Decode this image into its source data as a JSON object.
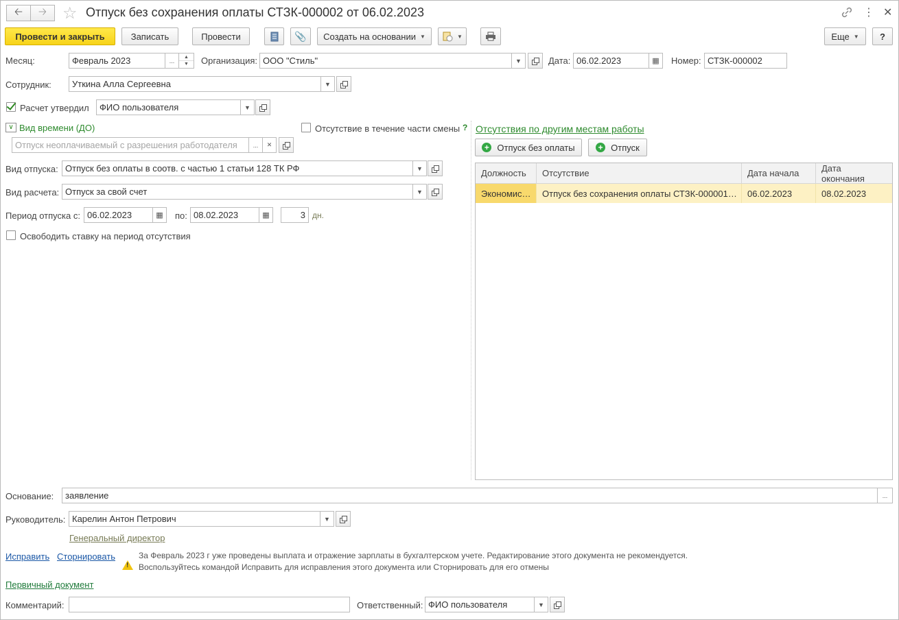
{
  "window": {
    "title": "Отпуск без сохранения оплаты СТЗК-000002 от 06.02.2023"
  },
  "toolbar": {
    "post_close_label": "Провести и закрыть",
    "save_label": "Записать",
    "post_label": "Провести",
    "create_based_label": "Создать на основании",
    "more_label": "Еще",
    "help_label": "?"
  },
  "header": {
    "month_label": "Месяц:",
    "month_value": "Февраль 2023",
    "org_label": "Организация:",
    "org_value": "ООО \"Стиль\"",
    "date_label": "Дата:",
    "date_value": "06.02.2023",
    "number_label": "Номер:",
    "number_value": "СТЗК-000002",
    "employee_label": "Сотрудник:",
    "employee_value": "Уткина Алла Сергеевна",
    "approved_label": "Расчет утвердил",
    "approved_value": "ФИО пользователя"
  },
  "left": {
    "time_kind_label": "Вид времени (ДО)",
    "partial_shift_label": "Отсутствие в течение части смены",
    "help_mark": "?",
    "time_kind_placeholder": "Отпуск неоплачиваемый с разрешения работодателя",
    "leave_kind_label": "Вид отпуска:",
    "leave_kind_value": "Отпуск без оплаты в соотв. с частью 1 статьи 128 ТК РФ",
    "calc_kind_label": "Вид расчета:",
    "calc_kind_value": "Отпуск за свой счет",
    "period_from_label": "Период отпуска с:",
    "period_from_value": "06.02.2023",
    "period_to_label": "по:",
    "period_to_value": "08.02.2023",
    "days_value": "3",
    "days_unit": "дн.",
    "free_rate_label": "Освободить ставку на период отсутствия"
  },
  "right": {
    "section_title": "Отсутствия по другим местам работы",
    "btn_unpaid_label": "Отпуск без оплаты",
    "btn_leave_label": "Отпуск",
    "columns": [
      "Должность",
      "Отсутствие",
      "Дата начала",
      "Дата окончания"
    ],
    "rows": [
      [
        "Экономис…",
        "Отпуск без сохранения оплаты СТЗК-000001…",
        "06.02.2023",
        "08.02.2023"
      ]
    ]
  },
  "footer": {
    "basis_label": "Основание:",
    "basis_value": "заявление",
    "manager_label": "Руководитель:",
    "manager_value": "Карелин Антон Петрович",
    "manager_position": "Генеральный директор",
    "fix_link": "Исправить",
    "reverse_link": "Сторнировать",
    "warning_line1": "За Февраль 2023 г уже проведены выплата и отражение зарплаты в бухгалтерском учете. Редактирование этого документа не рекомендуется.",
    "warning_line2": "Воспользуйтесь командой Исправить для исправления этого документа или Сторнировать для его отмены",
    "primary_doc_link": "Первичный документ",
    "comment_label": "Комментарий:",
    "comment_value": "",
    "responsible_label": "Ответственный:",
    "responsible_value": "ФИО пользователя"
  },
  "colors": {
    "primary_button": "#f7d31a",
    "accent_green": "#2d8a2d",
    "link_blue": "#1a57a6",
    "row_highlight": "#fdf1c4"
  },
  "icons": [
    "back-arrow-icon",
    "forward-arrow-icon",
    "star-icon",
    "link-icon",
    "kebab-icon",
    "close-icon",
    "document-list-icon",
    "paperclip-icon",
    "attach-file-icon",
    "print-icon",
    "plus-icon",
    "warning-icon",
    "calendar-icon",
    "open-icon"
  ]
}
